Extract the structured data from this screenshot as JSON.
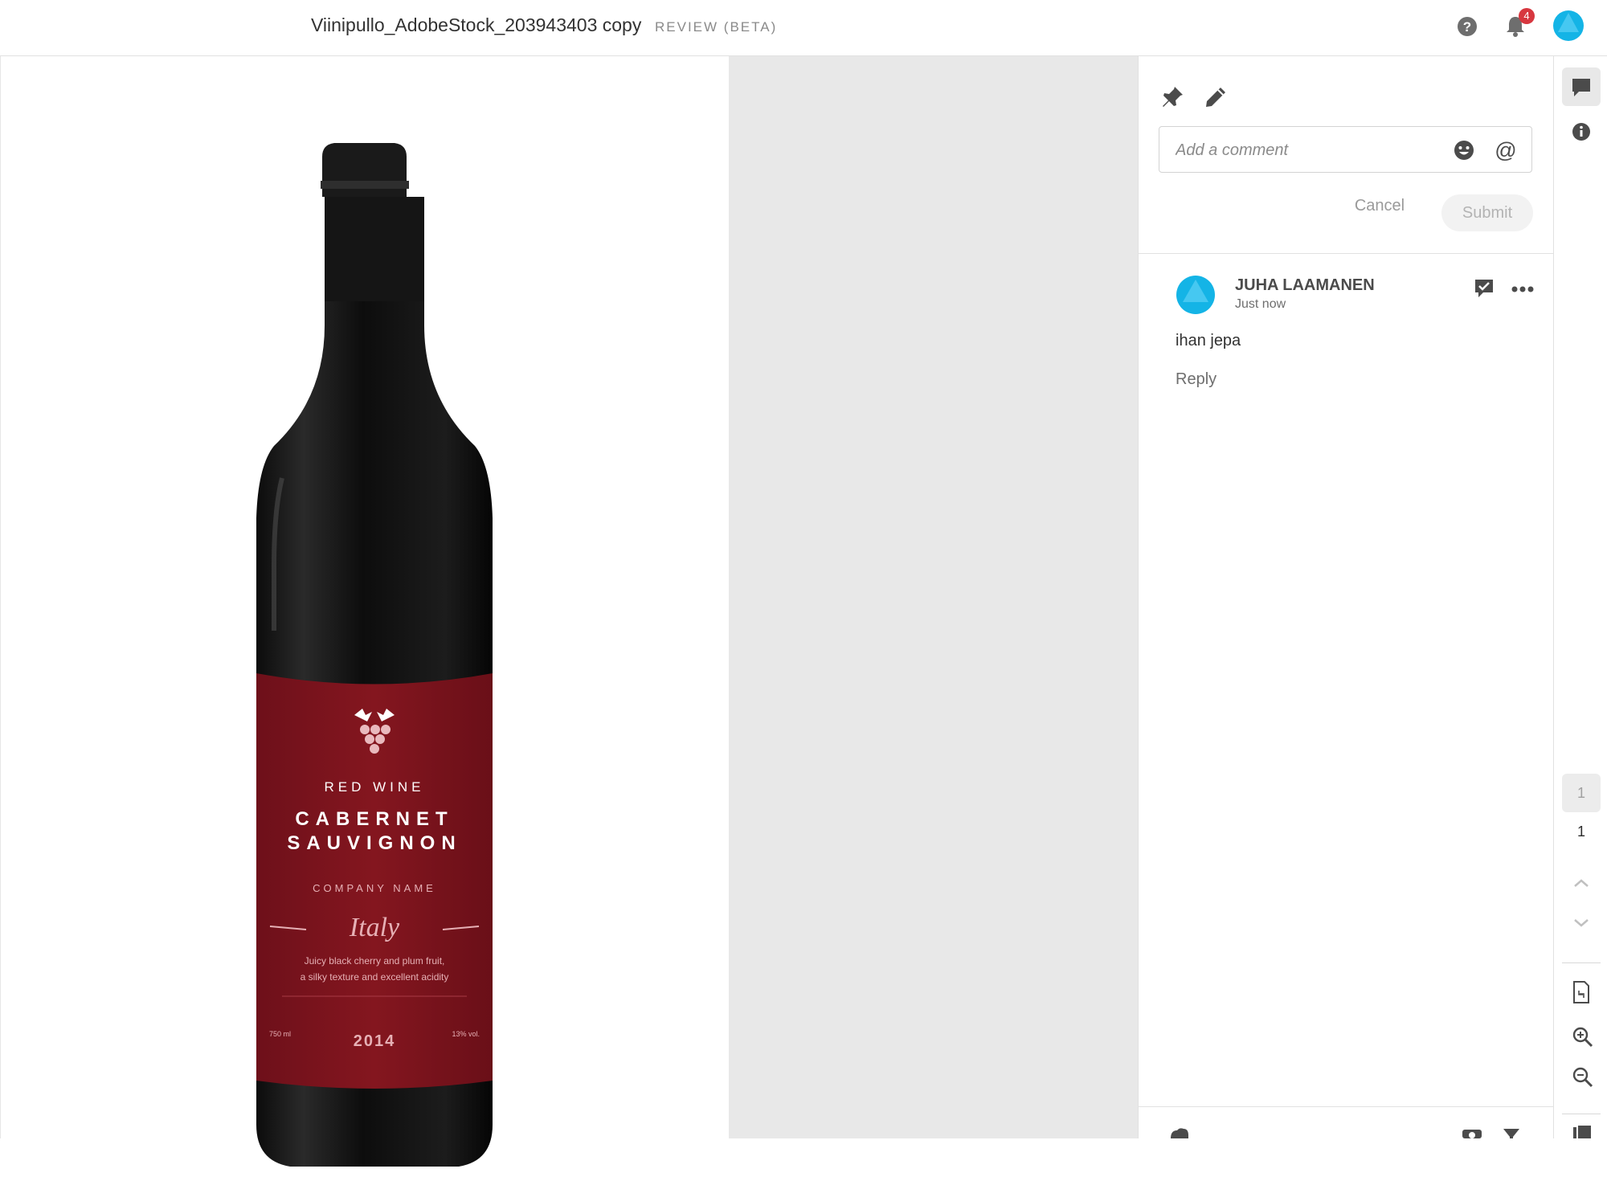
{
  "header": {
    "file_title": "Viinipullo_AdobeStock_203943403 copy",
    "mode_label": "REVIEW (BETA)",
    "notification_count": "4",
    "icons": [
      "help-icon",
      "bell-icon",
      "user-avatar"
    ]
  },
  "artwork": {
    "label_line1": "RED WINE",
    "label_line2": "CABERNET",
    "label_line3": "SAUVIGNON",
    "company": "COMPANY NAME",
    "origin": "Italy",
    "description_line1": "Juicy black cherry and plum fruit,",
    "description_line2": "a silky texture and excellent acidity",
    "volume": "750 ml",
    "year": "2014",
    "abv": "13% vol."
  },
  "comments_panel": {
    "input_placeholder": "Add a comment",
    "cancel_label": "Cancel",
    "submit_label": "Submit",
    "comments": [
      {
        "author": "JUHA LAAMANEN",
        "time": "Just now",
        "text": "ihan jepa",
        "reply_label": "Reply"
      }
    ]
  },
  "right_rail": {
    "current_page": "1",
    "total_pages": "1"
  },
  "colors": {
    "accent_avatar": "#14b4e6",
    "label_red": "#7e1420",
    "badge_red": "#d7373f",
    "canvas_gray": "#e8e8e8"
  }
}
